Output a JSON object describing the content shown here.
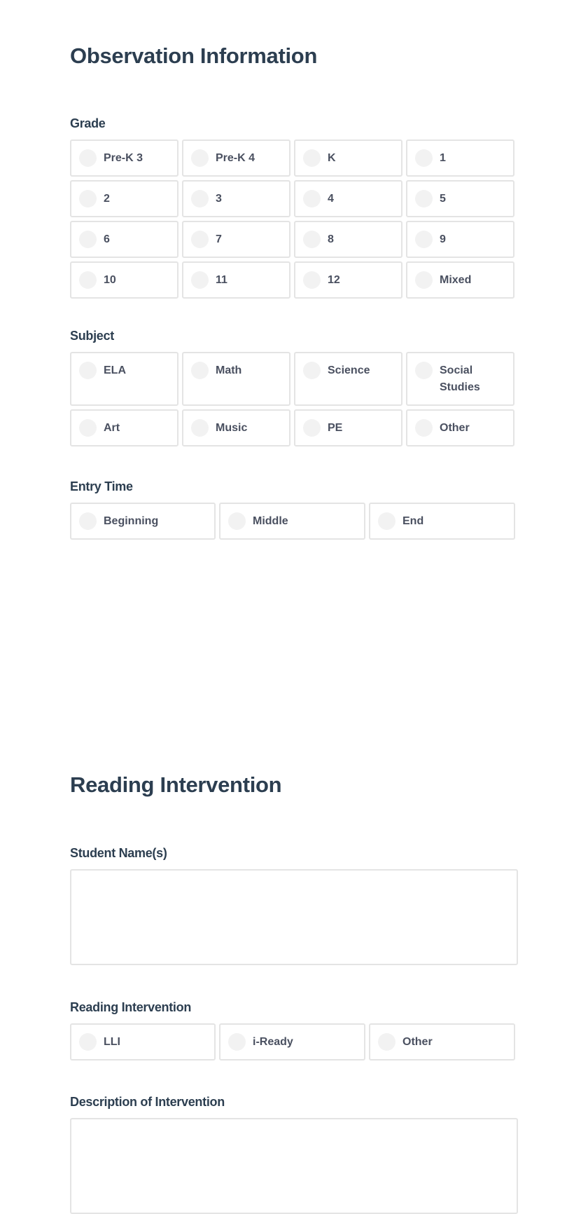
{
  "sections": {
    "observation": {
      "title": "Observation Information",
      "grade": {
        "label": "Grade",
        "options": [
          "Pre-K 3",
          "Pre-K 4",
          "K",
          "1",
          "2",
          "3",
          "4",
          "5",
          "6",
          "7",
          "8",
          "9",
          "10",
          "11",
          "12",
          "Mixed"
        ]
      },
      "subject": {
        "label": "Subject",
        "options": [
          "ELA",
          "Math",
          "Science",
          "Social Studies",
          "Art",
          "Music",
          "PE",
          "Other"
        ]
      },
      "entry_time": {
        "label": "Entry Time",
        "options": [
          "Beginning",
          "Middle",
          "End"
        ]
      }
    },
    "reading": {
      "title": "Reading Intervention",
      "student_names": {
        "label": "Student Name(s)",
        "value": ""
      },
      "intervention": {
        "label": "Reading Intervention",
        "options": [
          "LLI",
          "i-Ready",
          "Other"
        ]
      },
      "description": {
        "label": "Description of Intervention",
        "value": ""
      }
    }
  },
  "colors": {
    "heading": "#2c3e50",
    "option_text": "#4a5060",
    "border": "#e4e4e4",
    "radio_fill": "#f2f2f2"
  }
}
